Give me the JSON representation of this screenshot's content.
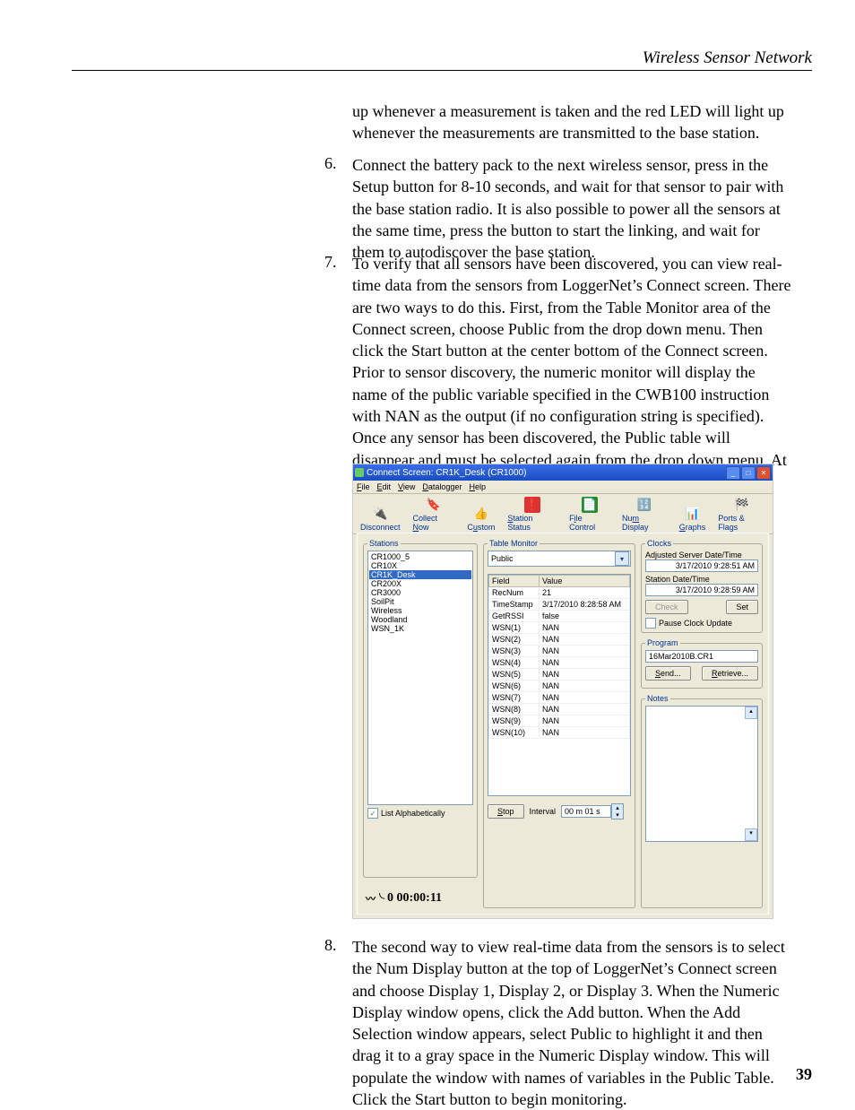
{
  "header": {
    "running_head": "Wireless Sensor Network"
  },
  "page_number": "39",
  "paragraphs": {
    "intro_tail": "up whenever a measurement is taken and the red LED will light up whenever the measurements are transmitted to the base station.",
    "item6_num": "6.",
    "item6": "Connect the battery pack to the next wireless sensor, press in the Setup button for 8-10 seconds, and wait for that sensor to pair with the base station radio.  It is also possible to power all the sensors at the same time, press the button to start the linking, and wait for them to autodiscover the base station.",
    "item7_num": "7.",
    "item7": "To verify that all sensors have been discovered, you can view real-time data from the sensors from LoggerNet’s Connect screen.  There are two ways to do this.  First, from the Table Monitor area of the Connect screen, choose Public from the drop down menu.  Then click the Start button at the center bottom of the Connect screen.  Prior to sensor discovery, the numeric monitor will display the name of the public variable specified in the CWB100 instruction with NAN as the output (if no configuration string is specified).  Once any sensor has been discovered, the Public table will disappear and must be selected again from the drop down menu.  At that time the newly discovered sensor names will appear in the Public table.  On the next datalogger scan, the sensor values will also appear.",
    "item8_num": "8.",
    "item8": "The second way to view real-time data from the sensors is to select the Num Display button at the top of LoggerNet’s Connect screen and choose Display 1, Display 2, or Display 3.  When the Numeric Display window opens, click the Add button.  When the Add Selection window appears, select Public to highlight it and then drag it to a gray space in the Numeric Display window.  This will populate the window with names of variables in the Public Table.  Click the Start button to begin monitoring."
  },
  "screenshot": {
    "title": "Connect Screen: CR1K_Desk (CR1000)",
    "menus": {
      "file": "File",
      "edit": "Edit",
      "view": "View",
      "datalogger": "Datalogger",
      "help": "Help"
    },
    "toolbar": {
      "disconnect": "Disconnect",
      "collect_now": "Collect Now",
      "custom": "Custom",
      "station_status": "Station Status",
      "file_control": "File Control",
      "num_display": "Num Display",
      "graphs": "Graphs",
      "ports_flags": "Ports & Flags"
    },
    "stations": {
      "legend": "Stations",
      "items": [
        "CR1000_5",
        "CR10X",
        "CR1K_Desk",
        "CR200X",
        "CR3000",
        "SoilPit",
        "Wireless",
        "Woodland",
        "WSN_1K"
      ],
      "selected_index": 2,
      "list_alpha_label": "List Alphabetically",
      "list_alpha_checked": true,
      "elapsed": "0 00:00:11"
    },
    "table_monitor": {
      "legend": "Table Monitor",
      "combo_value": "Public",
      "headers": {
        "field": "Field",
        "value": "Value"
      },
      "rows": [
        {
          "f": "RecNum",
          "v": "21"
        },
        {
          "f": "TimeStamp",
          "v": "3/17/2010 8:28:58 AM"
        },
        {
          "f": "GetRSSI",
          "v": "false"
        },
        {
          "f": "WSN(1)",
          "v": "NAN"
        },
        {
          "f": "WSN(2)",
          "v": "NAN"
        },
        {
          "f": "WSN(3)",
          "v": "NAN"
        },
        {
          "f": "WSN(4)",
          "v": "NAN"
        },
        {
          "f": "WSN(5)",
          "v": "NAN"
        },
        {
          "f": "WSN(6)",
          "v": "NAN"
        },
        {
          "f": "WSN(7)",
          "v": "NAN"
        },
        {
          "f": "WSN(8)",
          "v": "NAN"
        },
        {
          "f": "WSN(9)",
          "v": "NAN"
        },
        {
          "f": "WSN(10)",
          "v": "NAN"
        }
      ],
      "stop_btn": "Stop",
      "interval_label": "Interval",
      "interval_value": "00 m 01 s"
    },
    "clocks": {
      "legend": "Clocks",
      "adj_label": "Adjusted Server Date/Time",
      "adj_value": "3/17/2010 9:28:51 AM",
      "station_label": "Station Date/Time",
      "station_value": "3/17/2010 9:28:59 AM",
      "check_btn": "Check",
      "set_btn": "Set",
      "pause_label": "Pause Clock Update"
    },
    "program": {
      "legend": "Program",
      "value": "16Mar2010B.CR1",
      "send_btn": "Send...",
      "retrieve_btn": "Retrieve..."
    },
    "notes": {
      "legend": "Notes"
    }
  }
}
